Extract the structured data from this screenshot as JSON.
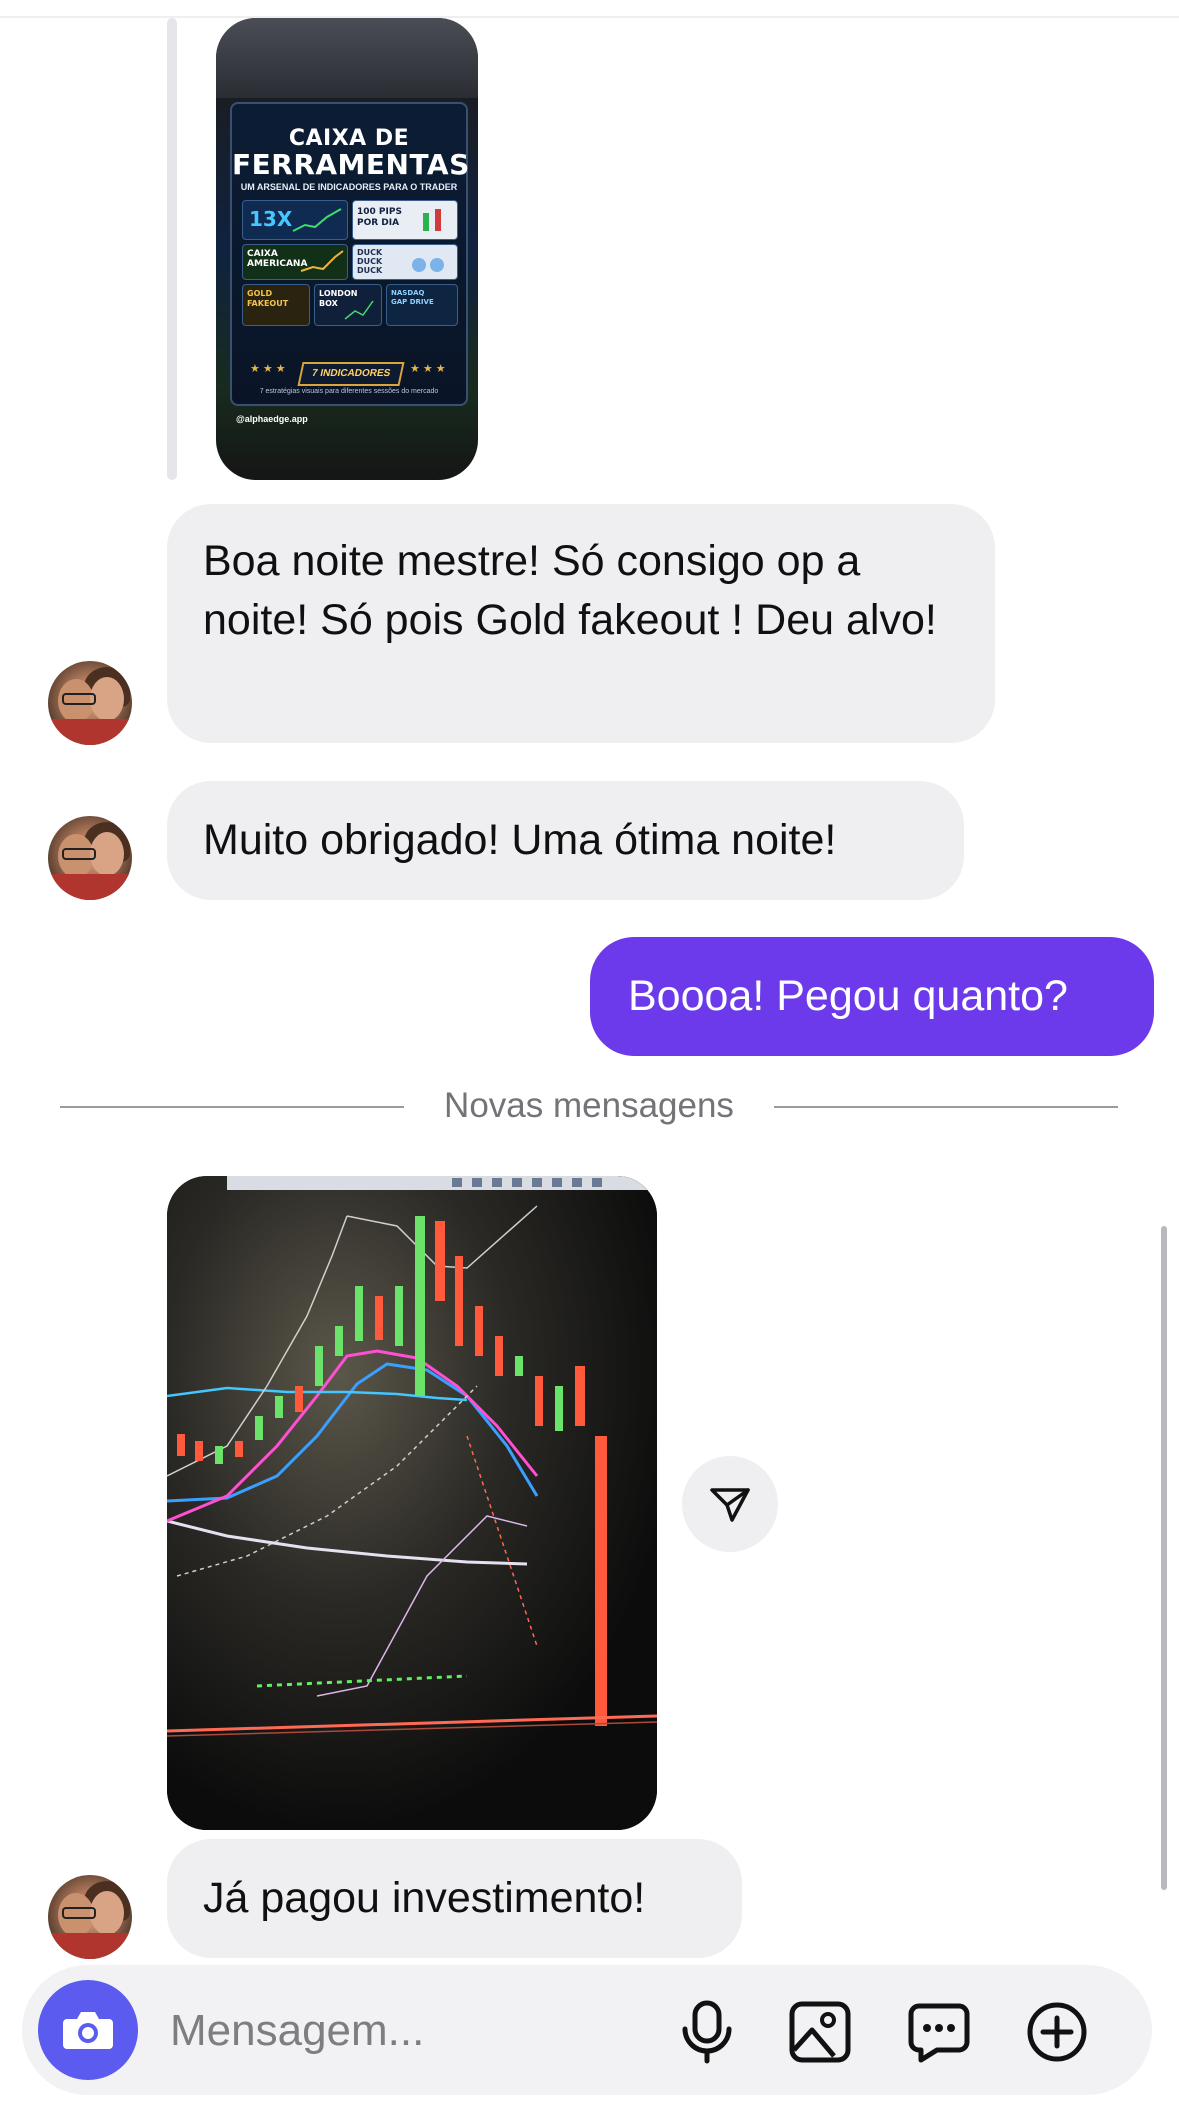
{
  "story": {
    "title_line1": "CAIXA DE",
    "title_line2": "FERRAMENTAS",
    "subtitle": "UM ARSENAL DE INDICADORES PARA O TRADER",
    "tiles": [
      "13X",
      "100 PIPS POR DIA",
      "CAIXA AMERICANA",
      "DUCK DUCK DUCK",
      "GOLD FAKEOUT",
      "LONDON BOX",
      "NASDAQ GAP DRIVE"
    ],
    "badge": "7 INDICADORES",
    "footer": "7 estratégias visuais para diferentes sessões do mercado",
    "handle": "@alphaedge.app"
  },
  "messages": [
    {
      "from": "contact",
      "text": "Boa noite mestre! Só consigo op a noite! Só pois Gold fakeout ! Deu alvo!"
    },
    {
      "from": "contact",
      "text": "Muito obrigado! Uma ótima noite!"
    },
    {
      "from": "me",
      "text": "Boooa! Pegou quanto?"
    },
    {
      "from": "contact",
      "text": "Já pagou investimento!"
    }
  ],
  "divider": {
    "label": "Novas mensagens"
  },
  "composer": {
    "placeholder": "Mensagem...",
    "icons": [
      "camera-icon",
      "microphone-icon",
      "gallery-icon",
      "sticker-icon",
      "plus-icon"
    ]
  },
  "colors": {
    "sent_bubble": "#6c3aea",
    "received_bubble": "#efeff2",
    "camera_button": "#5b5bf0"
  }
}
